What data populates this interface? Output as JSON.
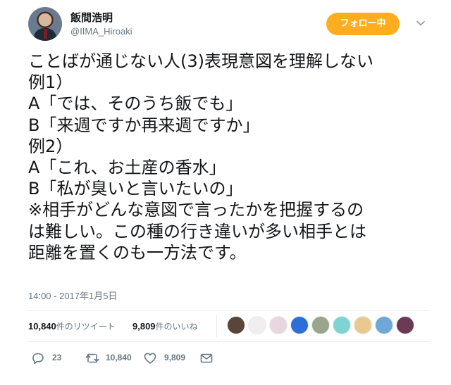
{
  "author": {
    "name": "飯間浩明",
    "handle": "@IIMA_Hiroaki"
  },
  "follow_button": {
    "label": "フォロー中",
    "color": "#ffad1f"
  },
  "tweet": {
    "lines": [
      "ことばが通じない人(3)表現意図を理解しない",
      "例1）",
      "A「では、そのうち飯でも」",
      "B「来週ですか再来週ですか」",
      "例2）",
      "A「これ、お土産の香水」",
      "B「私が臭いと言いたいの」",
      "※相手がどんな意図で言ったかを把握するの",
      "は難しい。この種の行き違いが多い相手とは",
      "距離を置くのも一方法です。"
    ],
    "timestamp": "14:00 - 2017年1月5日"
  },
  "stats": {
    "retweets_count": "10,840",
    "retweets_label": "件のリツイート",
    "likes_count": "9,809",
    "likes_label": "件のいいね"
  },
  "likers": [
    {
      "icon": "liker-avatar",
      "color": "#5a4638"
    },
    {
      "icon": "liker-avatar",
      "color": "#f0eeee"
    },
    {
      "icon": "liker-avatar",
      "color": "#e8d6e0"
    },
    {
      "icon": "liker-avatar",
      "color": "#2d6fd6"
    },
    {
      "icon": "liker-avatar",
      "color": "#9aa58a"
    },
    {
      "icon": "liker-avatar",
      "color": "#7fd3d3"
    },
    {
      "icon": "liker-avatar",
      "color": "#e9c98d"
    },
    {
      "icon": "liker-avatar",
      "color": "#6fa8d8"
    },
    {
      "icon": "liker-avatar",
      "color": "#6b3b56"
    }
  ],
  "actions": {
    "reply_count": "23",
    "retweet_count": "10,840",
    "like_count": "9,809"
  },
  "colors": {
    "text": "#14171a",
    "secondary": "#657786",
    "divider": "#e6ecf0"
  }
}
